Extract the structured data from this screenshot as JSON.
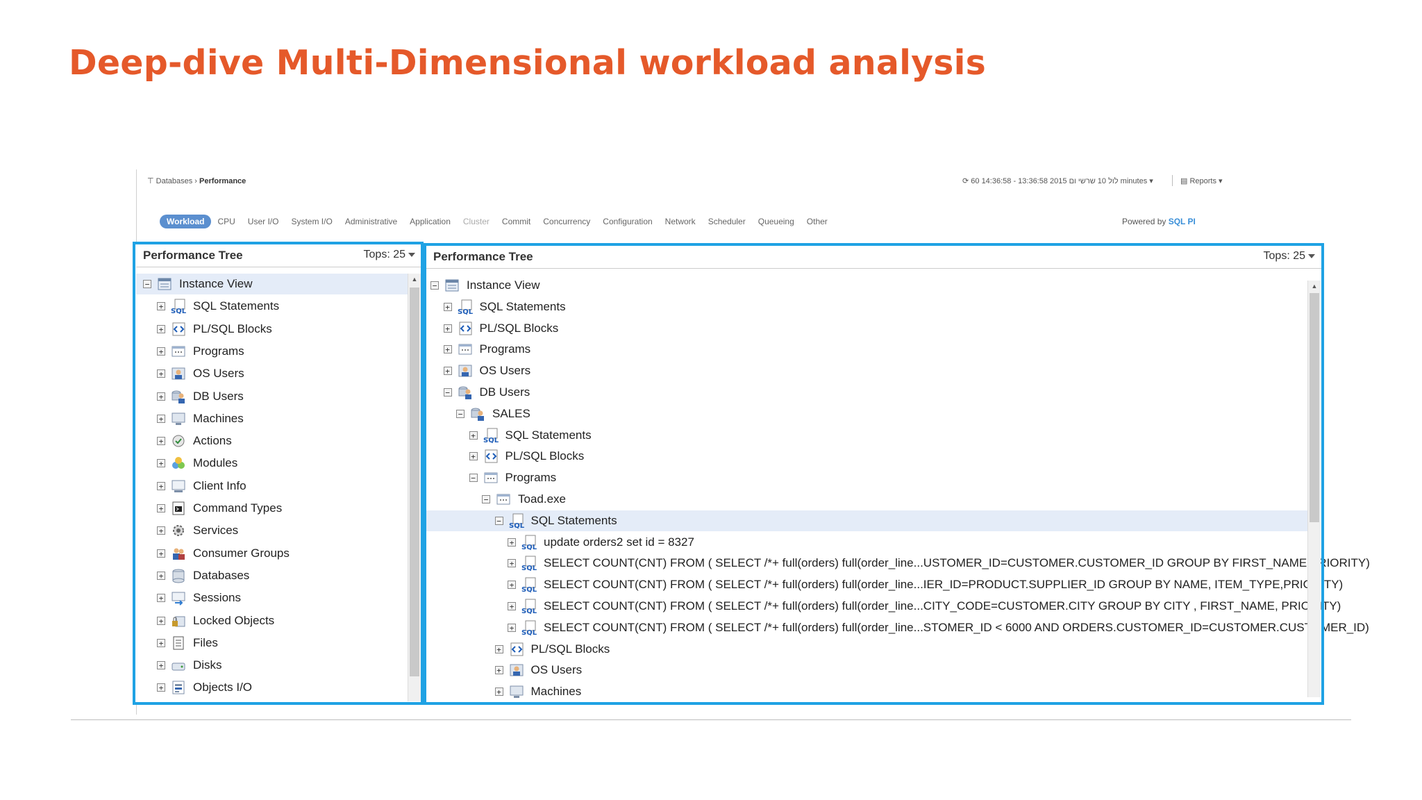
{
  "slide": {
    "title": "Deep-dive Multi-Dimensional workload analysis"
  },
  "header": {
    "breadcrumb": [
      "Databases",
      "Performance"
    ],
    "time_range": "⟳ 60 14:36:58 - 13:36:58 2015 לול 10 שרשי ום minutes",
    "reports_label": "Reports"
  },
  "tabs": [
    "Workload",
    "CPU",
    "User I/O",
    "System I/O",
    "Administrative",
    "Application",
    "Cluster",
    "Commit",
    "Concurrency",
    "Configuration",
    "Network",
    "Scheduler",
    "Queueing",
    "Other"
  ],
  "powered_by": {
    "text": "Powered by",
    "brand": "SQL PI"
  },
  "colors": {
    "title": "#e5592a",
    "highlight": "#1fa2e4",
    "selected_row": "#e4ecf8"
  },
  "left_panel": {
    "title": "Performance Tree",
    "tops": "Tops: 25",
    "items": [
      {
        "label": "Instance View",
        "icon": "instance-icon",
        "expander": "−"
      },
      {
        "label": "SQL Statements",
        "icon": "sql-icon",
        "expander": "+"
      },
      {
        "label": "PL/SQL Blocks",
        "icon": "plsql-icon",
        "expander": "+"
      },
      {
        "label": "Programs",
        "icon": "programs-icon",
        "expander": "+"
      },
      {
        "label": "OS Users",
        "icon": "os-user-icon",
        "expander": "+"
      },
      {
        "label": "DB Users",
        "icon": "db-user-icon",
        "expander": "+"
      },
      {
        "label": "Machines",
        "icon": "machine-icon",
        "expander": "+"
      },
      {
        "label": "Actions",
        "icon": "actions-icon",
        "expander": "+"
      },
      {
        "label": "Modules",
        "icon": "modules-icon",
        "expander": "+"
      },
      {
        "label": "Client Info",
        "icon": "client-info-icon",
        "expander": "+"
      },
      {
        "label": "Command Types",
        "icon": "command-icon",
        "expander": "+"
      },
      {
        "label": "Services",
        "icon": "services-icon",
        "expander": "+"
      },
      {
        "label": "Consumer Groups",
        "icon": "consumer-groups-icon",
        "expander": "+"
      },
      {
        "label": "Databases",
        "icon": "database-icon",
        "expander": "+"
      },
      {
        "label": "Sessions",
        "icon": "sessions-icon",
        "expander": "+"
      },
      {
        "label": "Locked Objects",
        "icon": "locked-objects-icon",
        "expander": "+"
      },
      {
        "label": "Files",
        "icon": "files-icon",
        "expander": "+"
      },
      {
        "label": "Disks",
        "icon": "disks-icon",
        "expander": "+"
      },
      {
        "label": "Objects I/O",
        "icon": "objects-io-icon",
        "expander": "+"
      }
    ]
  },
  "right_panel": {
    "title": "Performance Tree",
    "tops": "Tops: 25",
    "items": [
      {
        "label": "Instance View",
        "icon": "instance-icon",
        "expander": "−"
      },
      {
        "label": "SQL Statements",
        "icon": "sql-icon",
        "expander": "+"
      },
      {
        "label": "PL/SQL Blocks",
        "icon": "plsql-icon",
        "expander": "+"
      },
      {
        "label": "Programs",
        "icon": "programs-icon",
        "expander": "+"
      },
      {
        "label": "OS Users",
        "icon": "os-user-icon",
        "expander": "+"
      },
      {
        "label": "DB Users",
        "icon": "db-user-icon",
        "expander": "−"
      },
      {
        "label": "SALES",
        "icon": "db-user-icon",
        "expander": "−"
      },
      {
        "label": "SQL Statements",
        "icon": "sql-icon",
        "expander": "+"
      },
      {
        "label": "PL/SQL Blocks",
        "icon": "plsql-icon",
        "expander": "+"
      },
      {
        "label": "Programs",
        "icon": "programs-icon",
        "expander": "−"
      },
      {
        "label": "Toad.exe",
        "icon": "programs-icon",
        "expander": "−"
      },
      {
        "label": "SQL Statements",
        "icon": "sql-icon",
        "expander": "−"
      },
      {
        "label": "update orders2 set id = 8327",
        "icon": "sql-icon",
        "expander": "+"
      },
      {
        "label": "SELECT COUNT(CNT) FROM ( SELECT /*+ full(orders) full(order_line...USTOMER_ID=CUSTOMER.CUSTOMER_ID GROUP BY FIRST_NAME,PRIORITY)",
        "icon": "sql-icon",
        "expander": "+"
      },
      {
        "label": "SELECT COUNT(CNT) FROM ( SELECT /*+ full(orders) full(order_line...IER_ID=PRODUCT.SUPPLIER_ID GROUP BY NAME, ITEM_TYPE,PRIORITY)",
        "icon": "sql-icon",
        "expander": "+"
      },
      {
        "label": "SELECT COUNT(CNT) FROM ( SELECT /*+ full(orders) full(order_line...CITY_CODE=CUSTOMER.CITY GROUP BY CITY , FIRST_NAME, PRIORITY)",
        "icon": "sql-icon",
        "expander": "+"
      },
      {
        "label": "SELECT COUNT(CNT) FROM ( SELECT /*+ full(orders) full(order_line...STOMER_ID < 6000 AND ORDERS.CUSTOMER_ID=CUSTOMER.CUSTOMER_ID)",
        "icon": "sql-icon",
        "expander": "+"
      },
      {
        "label": "PL/SQL Blocks",
        "icon": "plsql-icon",
        "expander": "+"
      },
      {
        "label": "OS Users",
        "icon": "os-user-icon",
        "expander": "+"
      },
      {
        "label": "Machines",
        "icon": "machine-icon",
        "expander": "+"
      }
    ]
  }
}
